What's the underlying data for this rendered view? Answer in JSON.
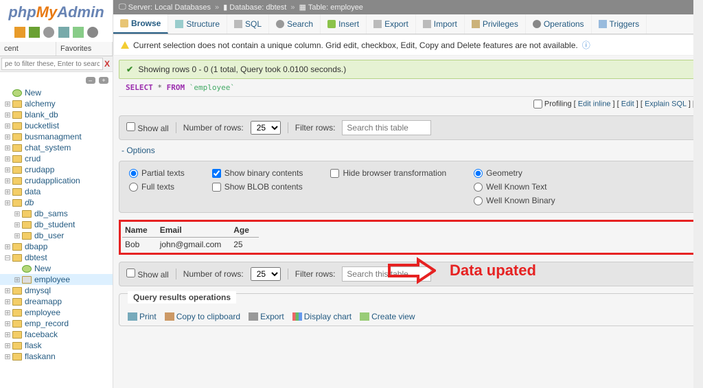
{
  "logo": {
    "php": "php",
    "my": "My",
    "admin": "Admin"
  },
  "sidebar_tabs": {
    "recent": "cent",
    "favorites": "Favorites"
  },
  "search_placeholder": "pe to filter these, Enter to search all",
  "search_x": "X",
  "tree": [
    {
      "label": "New",
      "new": true
    },
    {
      "label": "alchemy"
    },
    {
      "label": "blank_db"
    },
    {
      "label": "bucketlist"
    },
    {
      "label": "busmanagment"
    },
    {
      "label": "chat_system"
    },
    {
      "label": "crud"
    },
    {
      "label": "crudapp"
    },
    {
      "label": "crudapplication"
    },
    {
      "label": "data"
    },
    {
      "label": "db",
      "italic": true,
      "children": [
        {
          "label": "db_sams"
        },
        {
          "label": "db_student"
        },
        {
          "label": "db_user"
        }
      ]
    },
    {
      "label": "dbapp"
    },
    {
      "label": "dbtest",
      "expanded": true,
      "children": [
        {
          "label": "New",
          "new": true
        },
        {
          "label": "employee",
          "selected": true,
          "table": true
        }
      ]
    },
    {
      "label": "dmysql"
    },
    {
      "label": "dreamapp"
    },
    {
      "label": "employee"
    },
    {
      "label": "emp_record"
    },
    {
      "label": "faceback"
    },
    {
      "label": "flask"
    },
    {
      "label": "flaskann"
    }
  ],
  "breadcrumb": {
    "server_label": "Server:",
    "server_val": "Local Databases",
    "db_label": "Database:",
    "db_val": "dbtest",
    "table_label": "Table:",
    "table_val": "employee",
    "sep": "»"
  },
  "tabs": {
    "browse": "Browse",
    "structure": "Structure",
    "sql": "SQL",
    "search": "Search",
    "insert": "Insert",
    "export": "Export",
    "import": "Import",
    "privileges": "Privileges",
    "operations": "Operations",
    "triggers": "Triggers"
  },
  "warning": "Current selection does not contain a unique column. Grid edit, checkbox, Edit, Copy and Delete features are not available.",
  "result_msg": "Showing rows 0 - 0 (1 total, Query took 0.0100 seconds.)",
  "sql": {
    "select": "SELECT",
    "star": " * ",
    "from": "FROM",
    "table": " `employee`"
  },
  "tool_row": {
    "profiling": "Profiling",
    "edit_inline": "Edit inline",
    "edit": "Edit",
    "explain": "Explain SQL"
  },
  "controlbar": {
    "show_all": "Show all",
    "num_rows_label": "Number of rows:",
    "num_rows_val": "25",
    "filter_label": "Filter rows:",
    "filter_placeholder": "Search this table"
  },
  "options_label": "Options",
  "options": {
    "partial": "Partial texts",
    "full": "Full texts",
    "binary": "Show binary contents",
    "blob": "Show BLOB contents",
    "hide_trans": "Hide browser transformation",
    "geometry": "Geometry",
    "wkt": "Well Known Text",
    "wkb": "Well Known Binary"
  },
  "result_cols": [
    "Name",
    "Email",
    "Age"
  ],
  "result_rows": [
    [
      "Bob",
      "john@gmail.com",
      "25"
    ]
  ],
  "annotation": "Data upated",
  "ops_legend": "Query results operations",
  "ops": {
    "print": "Print",
    "clip": "Copy to clipboard",
    "export": "Export",
    "chart": "Display chart",
    "view": "Create view"
  }
}
